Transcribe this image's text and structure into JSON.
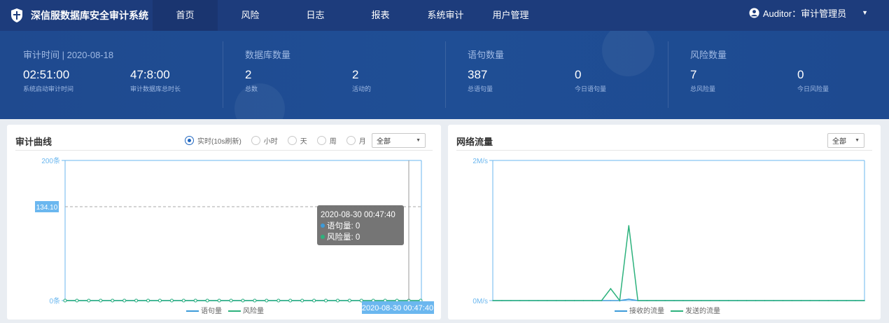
{
  "brand": {
    "title": "深信服数据库安全审计系统"
  },
  "nav": [
    {
      "label": "首页",
      "active": true
    },
    {
      "label": "风险",
      "active": false
    },
    {
      "label": "日志",
      "active": false
    },
    {
      "label": "报表",
      "active": false
    },
    {
      "label": "系统审计",
      "active": false
    },
    {
      "label": "用户管理",
      "active": false
    }
  ],
  "user": {
    "label": "Auditor：审计管理员"
  },
  "stats": {
    "audit": {
      "title": "审计时间  |  2020-08-18",
      "a_value": "02:51:00",
      "a_label": "系统启动审计时间",
      "b_value": "47:8:00",
      "b_label": "审计数据库总时长"
    },
    "db": {
      "title": "数据库数量",
      "a_value": "2",
      "a_label": "总数",
      "b_value": "2",
      "b_label": "活动的"
    },
    "stmt": {
      "title": "语句数量",
      "a_value": "387",
      "a_label": "总语句量",
      "b_value": "0",
      "b_label": "今日语句量"
    },
    "risk": {
      "title": "风险数量",
      "a_value": "7",
      "a_label": "总风险量",
      "b_value": "0",
      "b_label": "今日风险量"
    }
  },
  "audit_panel": {
    "title": "审计曲线",
    "radios": [
      {
        "label": "实时(10s刷新)",
        "checked": true
      },
      {
        "label": "小时",
        "checked": false
      },
      {
        "label": "天",
        "checked": false
      },
      {
        "label": "周",
        "checked": false
      },
      {
        "label": "月",
        "checked": false
      }
    ],
    "select_value": "全部",
    "marker_value": "134.10",
    "tooltip": {
      "time": "2020-08-30 00:47:40",
      "line1": "语句量: 0",
      "line2": "风险量: 0"
    },
    "axis_pointer_label": "2020-08-30 00:47:40"
  },
  "network_panel": {
    "title": "网络流量",
    "select_value": "全部"
  },
  "colors": {
    "nav_bg": "#1d3c7c",
    "banner_bg": "#1f4a8f",
    "series_blue": "#3d9bd9",
    "series_green": "#2db27d"
  },
  "chart_data": [
    {
      "type": "line",
      "title": "审计曲线",
      "ylim": [
        0,
        200
      ],
      "y_tick_labels": [
        "200条",
        "0条"
      ],
      "series": [
        {
          "name": "语句量",
          "color": "#3d9bd9",
          "values": [
            0,
            0,
            0,
            0,
            0,
            0,
            0,
            0,
            0,
            0,
            0,
            0,
            0,
            0,
            0,
            0,
            0,
            0,
            0,
            0,
            0,
            0,
            0,
            0,
            0,
            0,
            0,
            0,
            0,
            0,
            0
          ]
        },
        {
          "name": "风险量",
          "color": "#2db27d",
          "values": [
            0,
            0,
            0,
            0,
            0,
            0,
            0,
            0,
            0,
            0,
            0,
            0,
            0,
            0,
            0,
            0,
            0,
            0,
            0,
            0,
            0,
            0,
            0,
            0,
            0,
            0,
            0,
            0,
            0,
            0,
            0
          ]
        }
      ],
      "legend": "bottom-center",
      "grid": false
    },
    {
      "type": "line",
      "title": "网络流量",
      "y_tick_labels": [
        "2M/s",
        "0M/s"
      ],
      "series": [
        {
          "name": "接收的流量",
          "color": "#3d9bd9",
          "values": [
            0,
            0,
            0,
            0,
            0,
            0,
            0,
            0,
            0,
            0,
            0,
            0,
            0,
            0,
            0,
            0.02,
            0,
            0,
            0,
            0,
            0,
            0,
            0,
            0,
            0,
            0,
            0,
            0,
            0,
            0,
            0,
            0,
            0,
            0,
            0,
            0,
            0,
            0,
            0,
            0,
            0,
            0
          ]
        },
        {
          "name": "发送的流量",
          "color": "#2db27d",
          "values": [
            0,
            0,
            0,
            0,
            0,
            0,
            0,
            0,
            0,
            0,
            0,
            0,
            0,
            0.17,
            0,
            1.07,
            0,
            0,
            0,
            0,
            0,
            0,
            0,
            0,
            0,
            0,
            0,
            0,
            0,
            0,
            0,
            0,
            0,
            0,
            0,
            0,
            0,
            0,
            0,
            0,
            0,
            0
          ]
        }
      ],
      "legend": "bottom-center",
      "grid": false
    }
  ]
}
